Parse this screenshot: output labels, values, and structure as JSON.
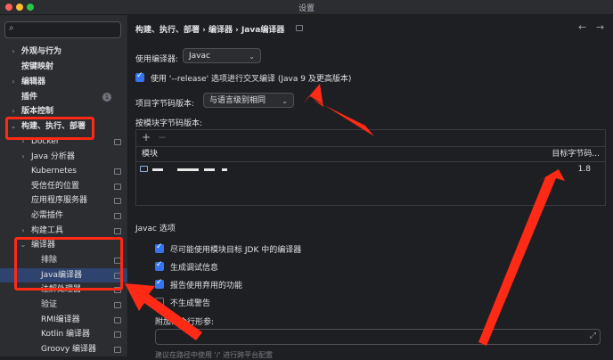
{
  "window": {
    "title": "设置"
  },
  "search": {
    "placeholder": ""
  },
  "sidebar": {
    "items": [
      {
        "label": "外观与行为",
        "chev": "›",
        "bold": true
      },
      {
        "label": "按键映射",
        "bold": true
      },
      {
        "label": "编辑器",
        "chev": "›",
        "bold": true
      },
      {
        "label": "插件",
        "bold": true,
        "badge": "1"
      },
      {
        "label": "版本控制",
        "chev": "›",
        "bold": true
      },
      {
        "label": "构建、执行、部署",
        "chev": "⌄",
        "bold": true
      },
      {
        "label": "Docker",
        "chev": "›"
      },
      {
        "label": "Java 分析器",
        "chev": "›"
      },
      {
        "label": "Kubernetes"
      },
      {
        "label": "受信任的位置"
      },
      {
        "label": "应用程序服务器"
      },
      {
        "label": "必需插件"
      },
      {
        "label": "构建工具",
        "chev": "›"
      },
      {
        "label": "编译器",
        "chev": "⌄"
      },
      {
        "label": "排除"
      },
      {
        "label": "Java编译器"
      },
      {
        "label": "注解处理器"
      },
      {
        "label": "验证"
      },
      {
        "label": "RMI编译器"
      },
      {
        "label": "Kotlin 编译器"
      },
      {
        "label": "Groovy 编译器"
      }
    ]
  },
  "header": {
    "breadcrumb": "构建、执行、部署 › 编译器 › Java编译器",
    "back": "←",
    "forward": "→"
  },
  "compiler": {
    "label": "使用编译器:",
    "value": "Javac",
    "release_label": "使用 '--release' 选项进行交叉编译 (Java 9 及更高版本)",
    "bytecode_label": "项目字节码版本:",
    "bytecode_value": "与语言级别相同",
    "per_module_label": "按模块字节码版本:"
  },
  "table": {
    "add": "+",
    "remove": "−",
    "col_module": "模块",
    "col_target": "目标字节码...",
    "rows": [
      {
        "target": "1.8"
      }
    ]
  },
  "javac": {
    "title": "Javac 选项",
    "options": [
      {
        "label": "尽可能使用模块目标 JDK 中的编译器",
        "checked": true
      },
      {
        "label": "生成调试信息",
        "checked": true
      },
      {
        "label": "报告使用弃用的功能",
        "checked": true
      },
      {
        "label": "不生成警告",
        "checked": false
      }
    ],
    "params_label": "附加命令行形参:",
    "params_value": "",
    "expand": "⤢",
    "hint": "建议在路径中使用 '/' 进行跨平台配置"
  },
  "colors": {
    "accent": "#3574f0",
    "annotation": "#ff2a16",
    "selection": "#2e436e"
  }
}
